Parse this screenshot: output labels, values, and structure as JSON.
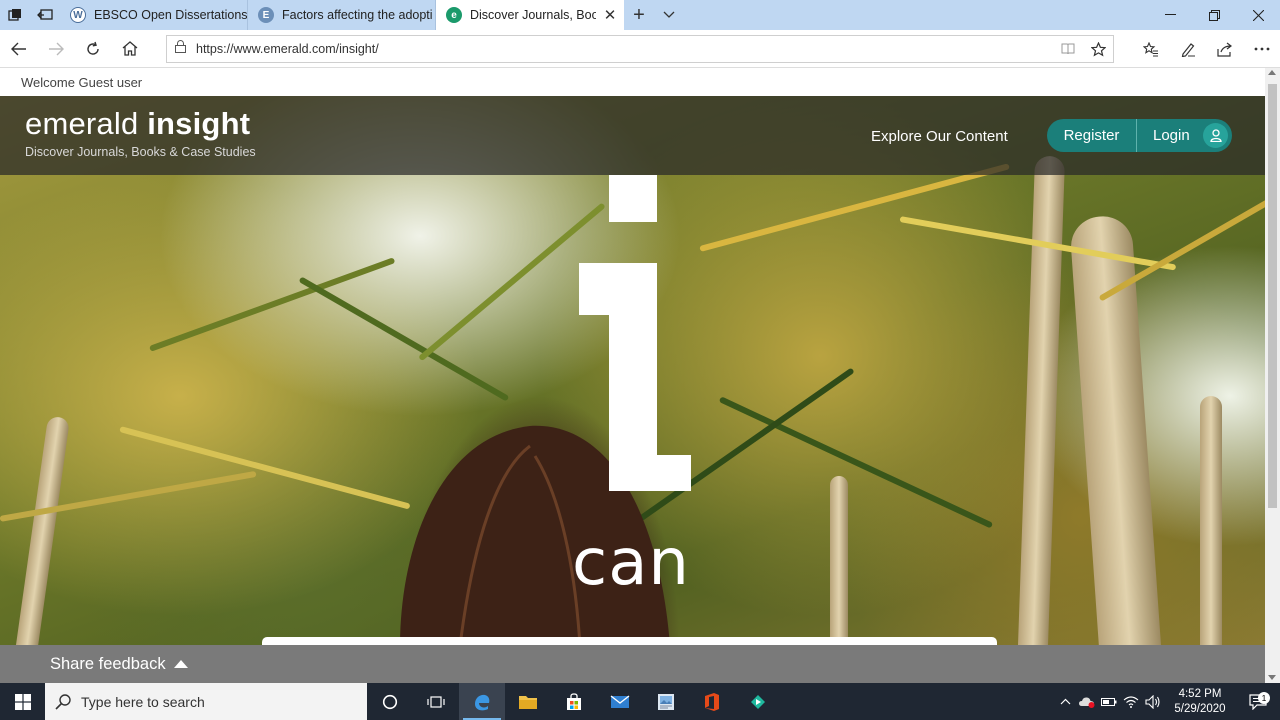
{
  "browser": {
    "tabs": [
      {
        "title": "EBSCO Open Dissertations F",
        "favicon": "wordpress-icon",
        "active": false
      },
      {
        "title": "Factors affecting the adopti",
        "favicon": "ebsco-icon",
        "active": false
      },
      {
        "title": "Discover Journals, Book",
        "favicon": "edge-icon",
        "active": true
      }
    ],
    "url": "https://www.emerald.com/insight/"
  },
  "page": {
    "welcome": "Welcome Guest user",
    "logo": {
      "word1": "emerald",
      "word2": "insight",
      "tagline": "Discover Journals, Books & Case Studies"
    },
    "nav": {
      "explore": "Explore Our Content",
      "register": "Register",
      "login": "Login"
    },
    "hero_word": "can",
    "accent_color": "#1b7f7a",
    "feedback": "Share feedback"
  },
  "taskbar": {
    "search_placeholder": "Type here to search",
    "time": "4:52 PM",
    "date": "5/29/2020",
    "notification_count": "1"
  }
}
